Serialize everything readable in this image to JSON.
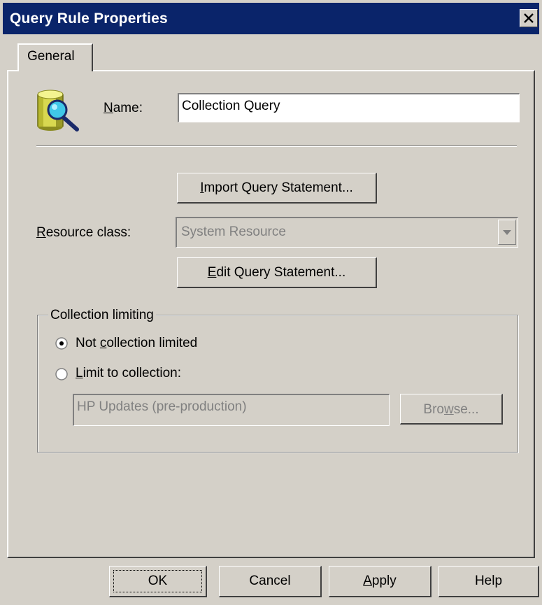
{
  "window": {
    "title": "Query Rule Properties"
  },
  "tabs": [
    {
      "label": "General"
    }
  ],
  "name_field": {
    "label_ul": "N",
    "label_rest": "ame:",
    "value": "Collection Query"
  },
  "import_button": {
    "ul": "I",
    "rest": "mport Query Statement..."
  },
  "resource_class": {
    "label_ul": "R",
    "label_rest": "esource class:",
    "value": "System Resource"
  },
  "edit_button": {
    "ul": "E",
    "rest": "dit Query Statement..."
  },
  "collection_limiting": {
    "legend": "Collection limiting",
    "option_not_limited": {
      "pre": "Not ",
      "ul": "c",
      "rest": "ollection limited",
      "selected": true
    },
    "option_limit_to": {
      "ul": "L",
      "rest": "imit to collection:",
      "selected": false
    },
    "collection_value": "HP Updates (pre-production)",
    "browse": {
      "pre": "Bro",
      "ul": "w",
      "rest": "se..."
    }
  },
  "buttons": {
    "ok": "OK",
    "cancel": "Cancel",
    "apply_ul": "A",
    "apply_rest": "pply",
    "help": "Help"
  }
}
